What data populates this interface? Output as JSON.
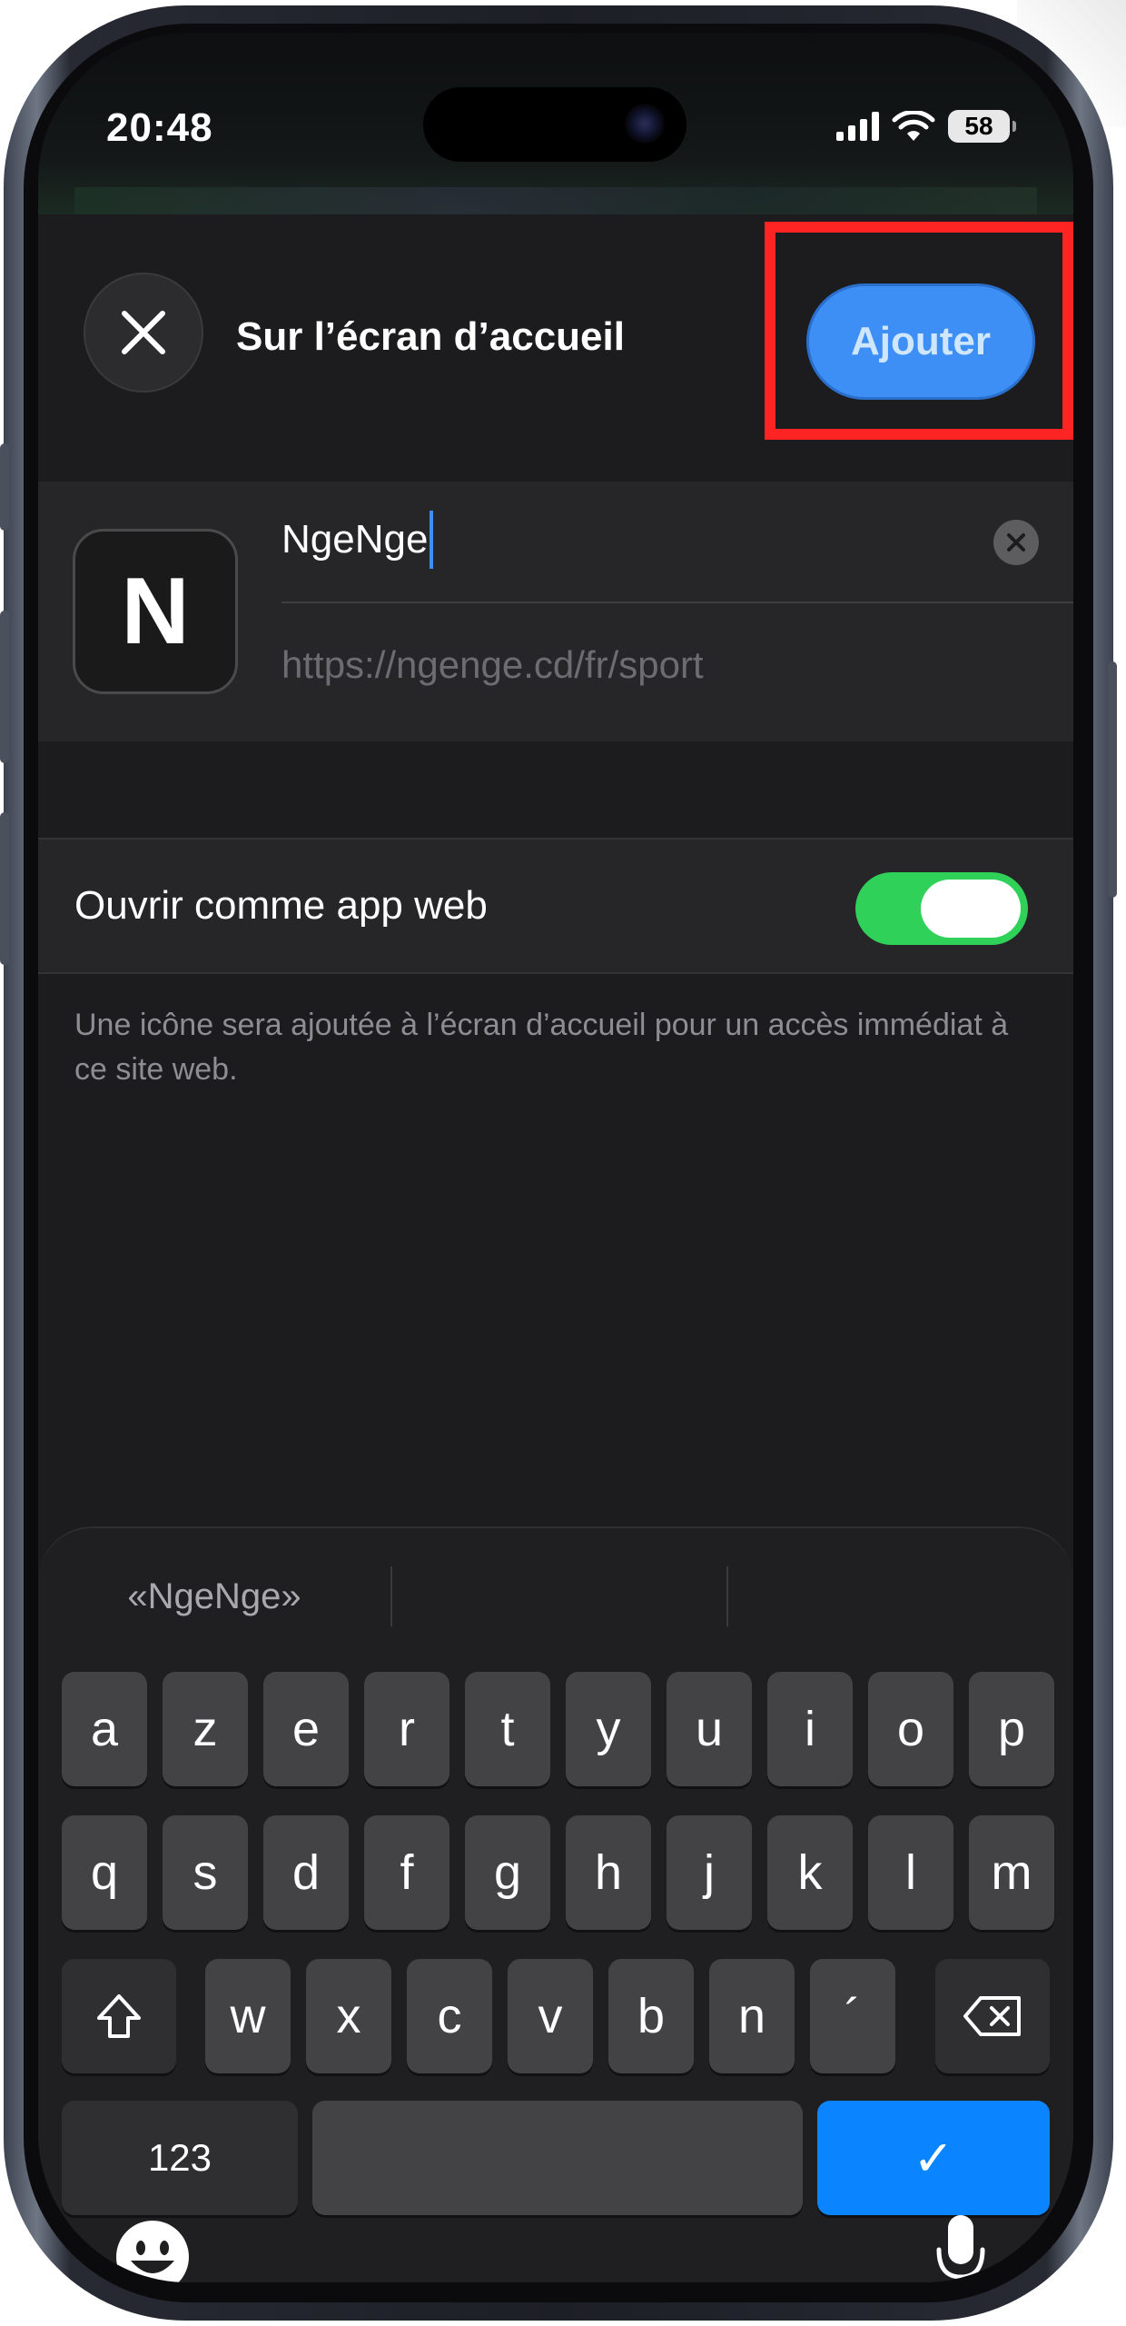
{
  "status_bar": {
    "time": "20:48",
    "battery": "58",
    "icons": [
      "cellular-signal-icon",
      "wifi-icon",
      "battery-icon"
    ]
  },
  "sheet": {
    "title": "Sur l’écran d’accueil",
    "close_icon": "close-icon",
    "add_label": "Ajouter",
    "app_icon_letter": "N",
    "name_value": "NgeNge",
    "url": "https://ngenge.cd/fr/sport",
    "toggle_label": "Ouvrir comme app web",
    "toggle_on": true,
    "footnote": "Une icône sera ajoutée à l’écran d’accueil pour un accès immédiat à ce site web."
  },
  "keyboard": {
    "suggestions": [
      "«NgeNge»",
      "",
      ""
    ],
    "row1": [
      "a",
      "z",
      "e",
      "r",
      "t",
      "y",
      "u",
      "i",
      "o",
      "p"
    ],
    "row2": [
      "q",
      "s",
      "d",
      "f",
      "g",
      "h",
      "j",
      "k",
      "l",
      "m"
    ],
    "row3": [
      "w",
      "x",
      "c",
      "v",
      "b",
      "n",
      "´"
    ],
    "numbers_label": "123",
    "confirm_glyph": "✓",
    "shift_icon": "shift-icon",
    "delete_icon": "delete-icon",
    "emoji_icon": "emoji-icon",
    "mic_icon": "microphone-icon"
  },
  "colors": {
    "accent": "#3d8ef5",
    "highlight": "#ff2424",
    "toggle": "#30d158",
    "confirm_key": "#0a84ff"
  }
}
